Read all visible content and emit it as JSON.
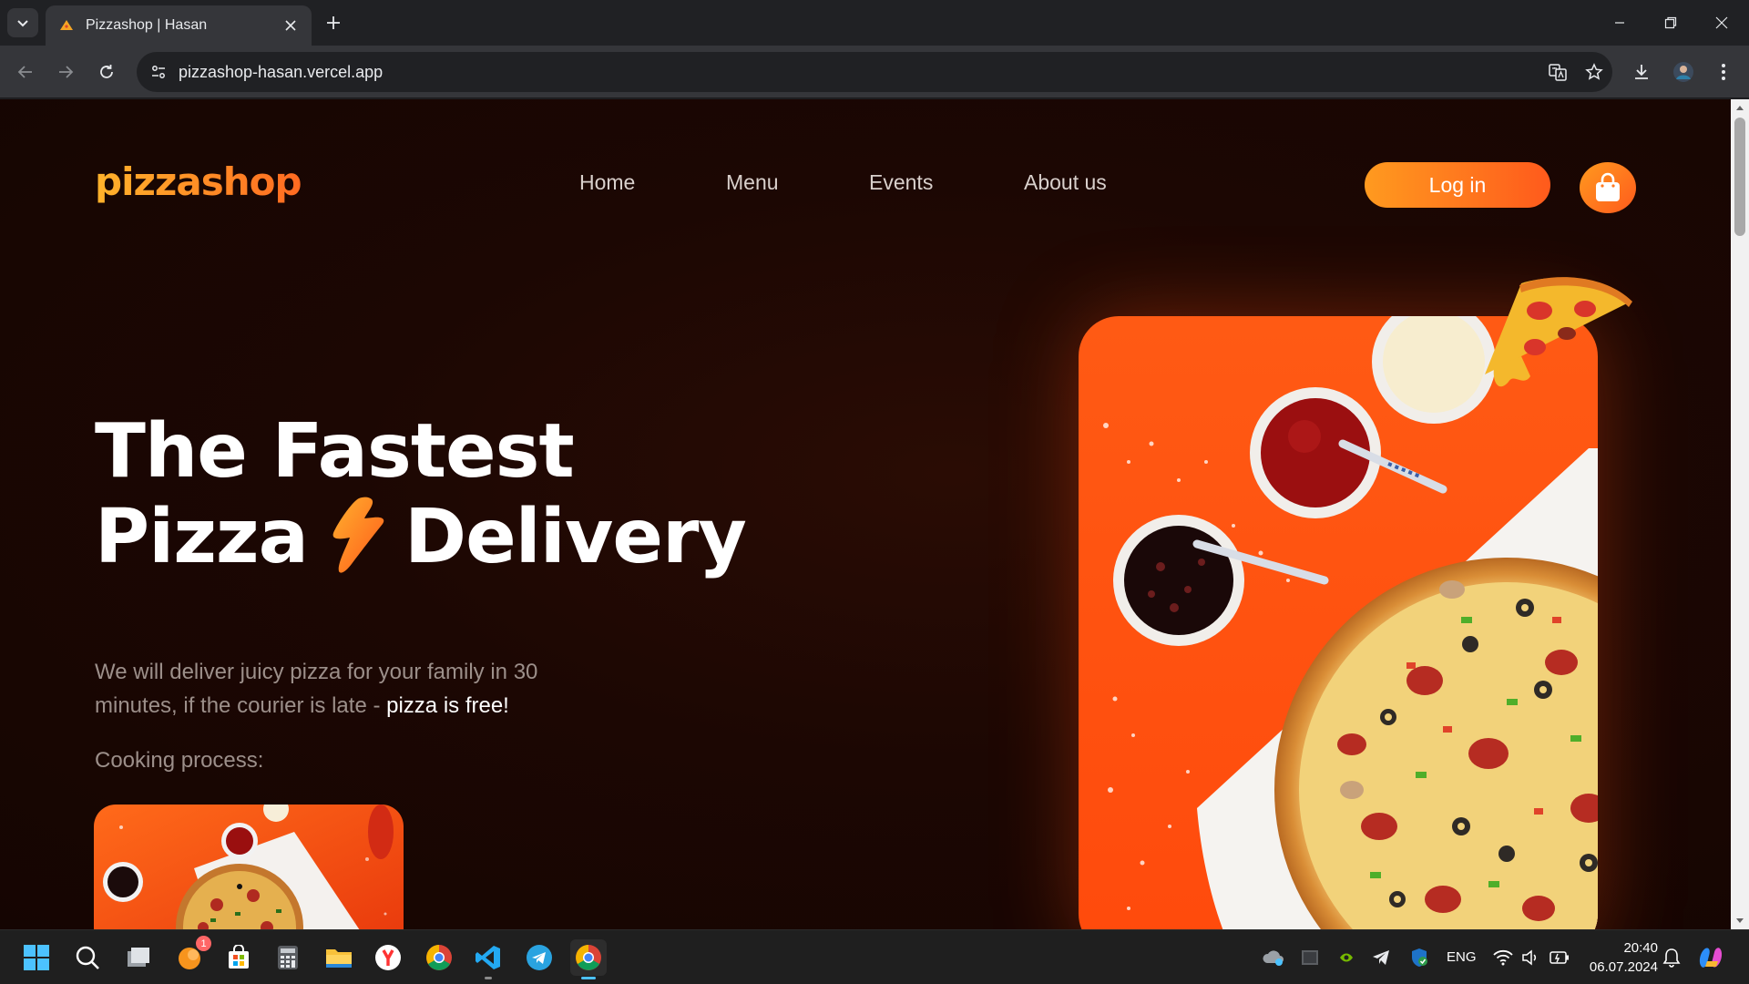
{
  "browser": {
    "tab_title": "Pizzashop | Hasan",
    "url": "pizzashop-hasan.vercel.app"
  },
  "site": {
    "logo": "pizzashop",
    "nav": [
      "Home",
      "Menu",
      "Events",
      "About us"
    ],
    "login_label": "Log in",
    "hero": {
      "line1": "The Fastest",
      "line2a": "Pizza",
      "line2b": "Delivery",
      "desc_start": "We will deliver juicy pizza for your family in 30 minutes, if the courier is late - ",
      "desc_highlight": "pizza is free!",
      "cooking_label": "Cooking process:"
    },
    "colors": {
      "accent_start": "#ffb32b",
      "accent_end": "#ff5a1c",
      "background": "#1c0703"
    }
  },
  "taskbar": {
    "language": "ENG",
    "time": "20:40",
    "date": "06.07.2024",
    "notification_badge": "1"
  }
}
